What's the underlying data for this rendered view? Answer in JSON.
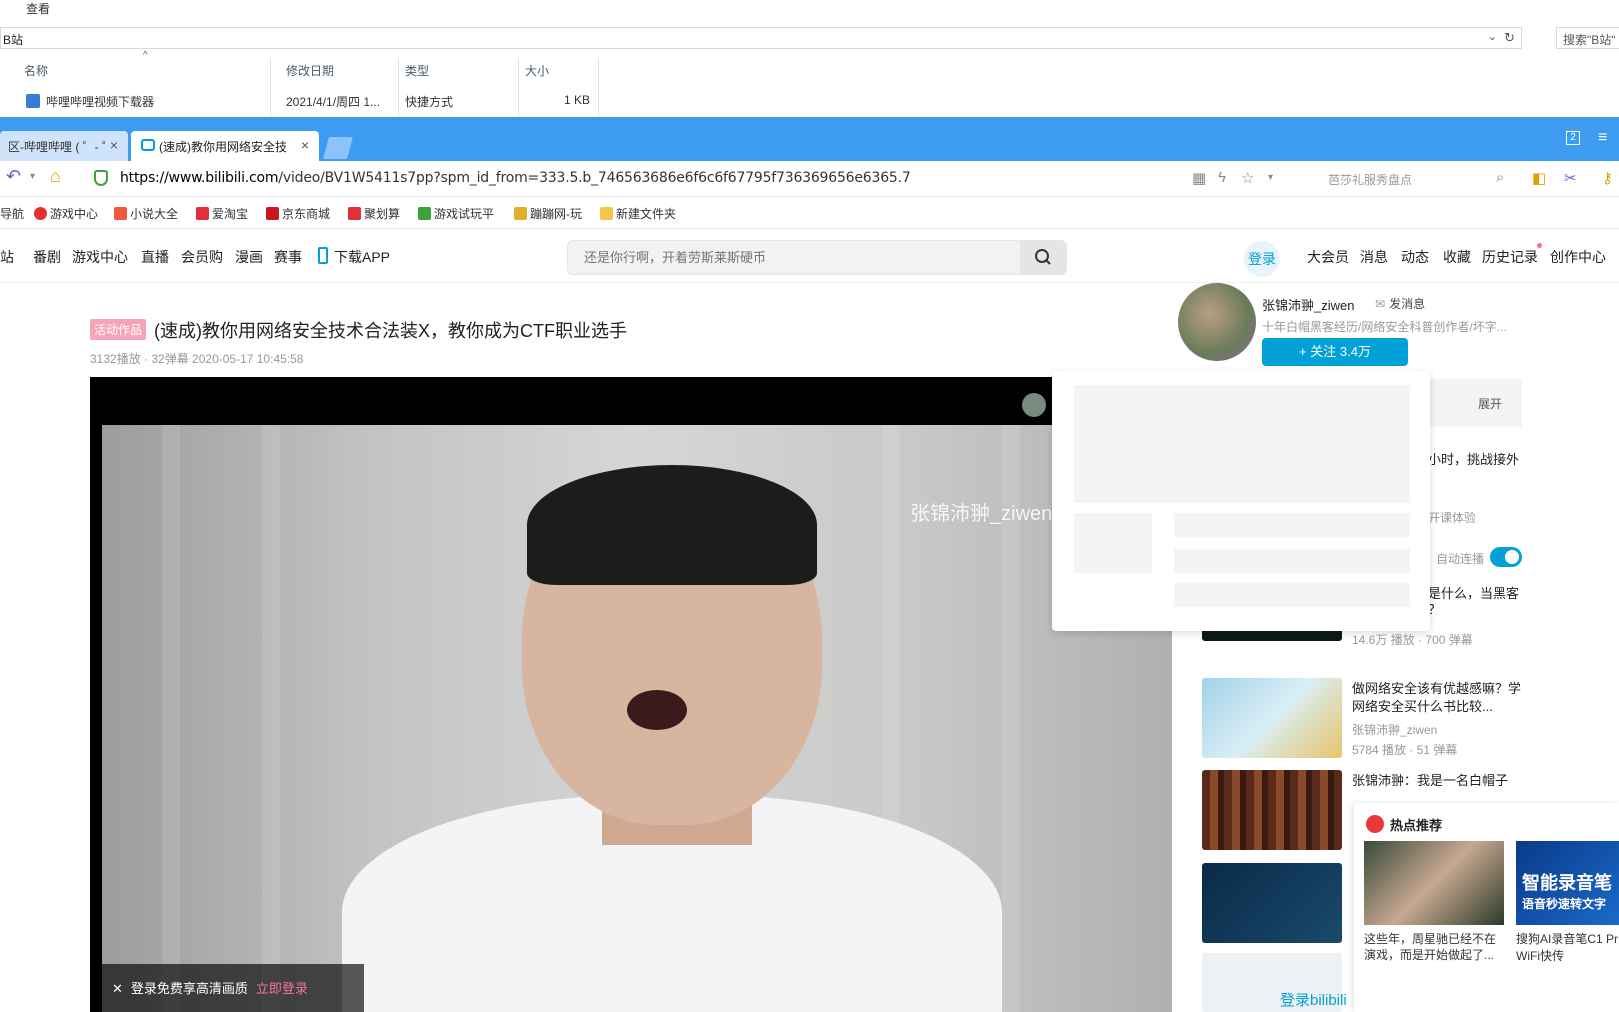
{
  "explorer": {
    "menu": "查看",
    "address": "B站",
    "search_placeholder": "搜索\"B站\"",
    "columns": [
      "名称",
      "修改日期",
      "类型",
      "大小"
    ],
    "file": {
      "name": "哔哩哔哩视频下载器",
      "date": "2021/4/1/周四 1...",
      "type": "快捷方式",
      "size": "1 KB"
    }
  },
  "browser": {
    "tabs": [
      {
        "label": "区-哔哩哔哩 ( ゜- ゜",
        "active": false
      },
      {
        "label": "(速成)教你用网络安全技",
        "active": true
      }
    ],
    "badge": "2",
    "url_host": "https://www.bilibili.com",
    "url_path": "/video/BV1W5411s7pp?spm_id_from=333.5.b_746563686e6f6c6f67795f736369656e6365.7",
    "search_placeholder": "芭莎礼服秀盘点",
    "bookmarks": [
      "导航",
      "游戏中心",
      "小说大全",
      "爱淘宝",
      "京东商城",
      "聚划算",
      "游戏试玩平",
      "蹦蹦网-玩",
      "新建文件夹"
    ]
  },
  "site": {
    "nav": [
      "站",
      "番剧",
      "游戏中心",
      "直播",
      "会员购",
      "漫画",
      "赛事",
      "下载APP"
    ],
    "search_placeholder": "还是你行啊，开着劳斯莱斯硬币",
    "login": "登录",
    "right_nav": [
      "大会员",
      "消息",
      "动态",
      "收藏",
      "历史记录",
      "创作中心"
    ]
  },
  "video": {
    "tag": "活动作品",
    "title": "(速成)教你用网络安全技术合法装X，教你成为CTF职业选手",
    "meta": "3132播放 · 32弹幕    2020-05-17 10:45:58",
    "watermark": "张锦沛翀_ziwen",
    "login_banner": "登录免费享高清画质",
    "login_link": "立即登录"
  },
  "uploader": {
    "name": "张锦沛翀_ziwen",
    "message": "发消息",
    "desc": "十年白帽黑客经历/网络安全科普创作者/坏字...",
    "follow": "+ 关注 3.4万"
  },
  "sidebar": {
    "expand": "展开",
    "frag1": "小时，挑战接外",
    "frag2": "开课体验",
    "autoplay": "自动连播",
    "frag3": "是什么，当黑客",
    "frag4": "？",
    "rec1_stats": "14.6万 播放 · 700 弹幕",
    "rec2_title": "做网络安全该有优越感嘛？学网络安全买什么书比较...",
    "rec2_up": "张锦沛翀_ziwen",
    "rec2_stats": "5784 播放 · 51 弹幕",
    "rec3_title": "张锦沛翀：我是一名白帽子",
    "login_bili": "登录bilibili"
  },
  "hot": {
    "title": "热点推荐",
    "item1": "这些年，周星驰已经不在演戏，而是开始做起了...",
    "item2_title": "搜狗AI录音笔C1 Pr",
    "item2_sub": "WiFi快传",
    "ad_text1": "智能录音笔",
    "ad_text2": "语音秒速转文字"
  }
}
